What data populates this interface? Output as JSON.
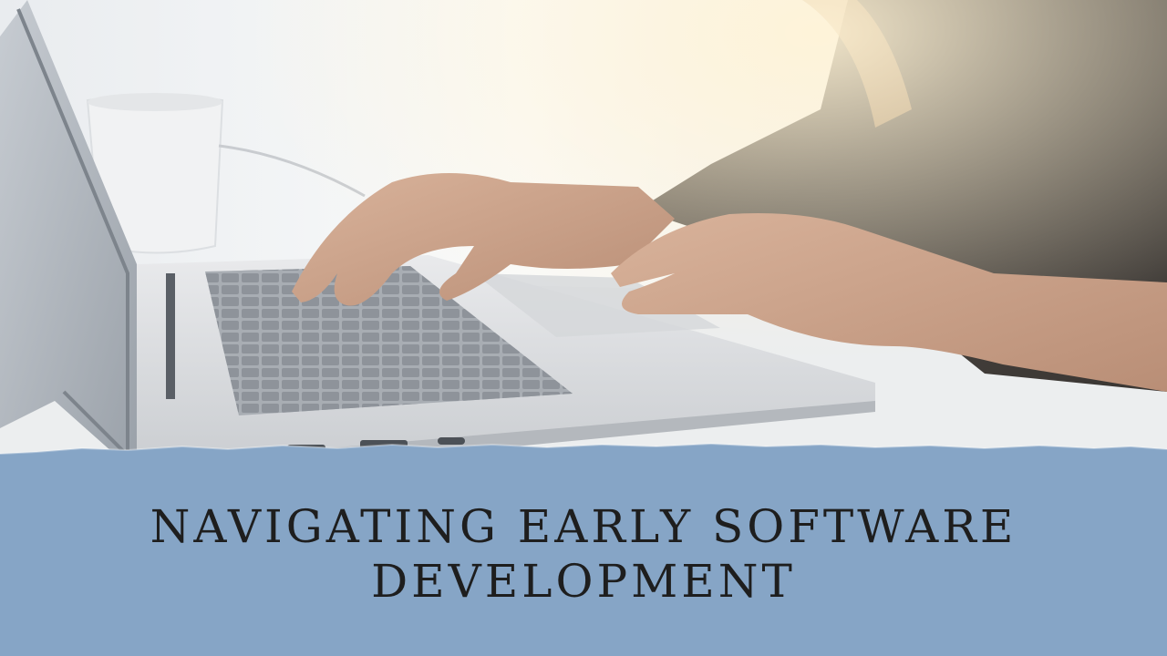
{
  "title": {
    "line1": "NAVIGATING EARLY SOFTWARE",
    "line2": "DEVELOPMENT"
  },
  "colors": {
    "banner": "#86a5c6",
    "title_text": "#1e1e1e",
    "background": "#f4f5f6"
  },
  "icons": [
    "laptop-illustration",
    "hands-typing-illustration",
    "coffee-mug-illustration"
  ]
}
